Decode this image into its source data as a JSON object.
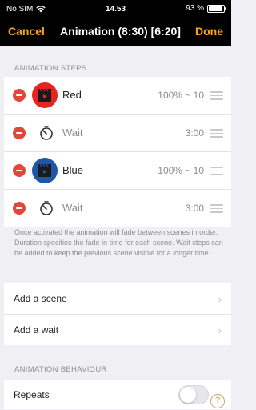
{
  "status_bar": {
    "carrier": "No SIM",
    "time": "14.53",
    "battery_percent": "93 %",
    "battery_level": 0.93
  },
  "nav": {
    "cancel_label": "Cancel",
    "title": "Animation (8:30) [6:20]",
    "done_label": "Done",
    "accent_color": "#f4a51c"
  },
  "steps_section": {
    "header": "ANIMATION STEPS",
    "items": [
      {
        "type": "scene",
        "name": "Red",
        "value": "100% ~ 10",
        "badge_color": "#e3261f",
        "icon": "scene-clapper-icon"
      },
      {
        "type": "wait",
        "name": "Wait",
        "value": "3:00",
        "icon": "timer-icon"
      },
      {
        "type": "scene",
        "name": "Blue",
        "value": "100% ~ 10",
        "badge_color": "#1f57a8",
        "icon": "scene-clapper-icon"
      },
      {
        "type": "wait",
        "name": "Wait",
        "value": "3:00",
        "icon": "timer-icon"
      }
    ]
  },
  "description": "Once activated the animation will fade between scenes in order. Duration specifies the fade in time for each scene. Wait steps can be added to keep the previous scene visible for a longer time.",
  "actions": {
    "add_scene": "Add a scene",
    "add_wait": "Add a wait"
  },
  "behaviour_section": {
    "header": "ANIMATION BEHAVIOUR",
    "repeats_label": "Repeats",
    "repeats_on": false
  }
}
